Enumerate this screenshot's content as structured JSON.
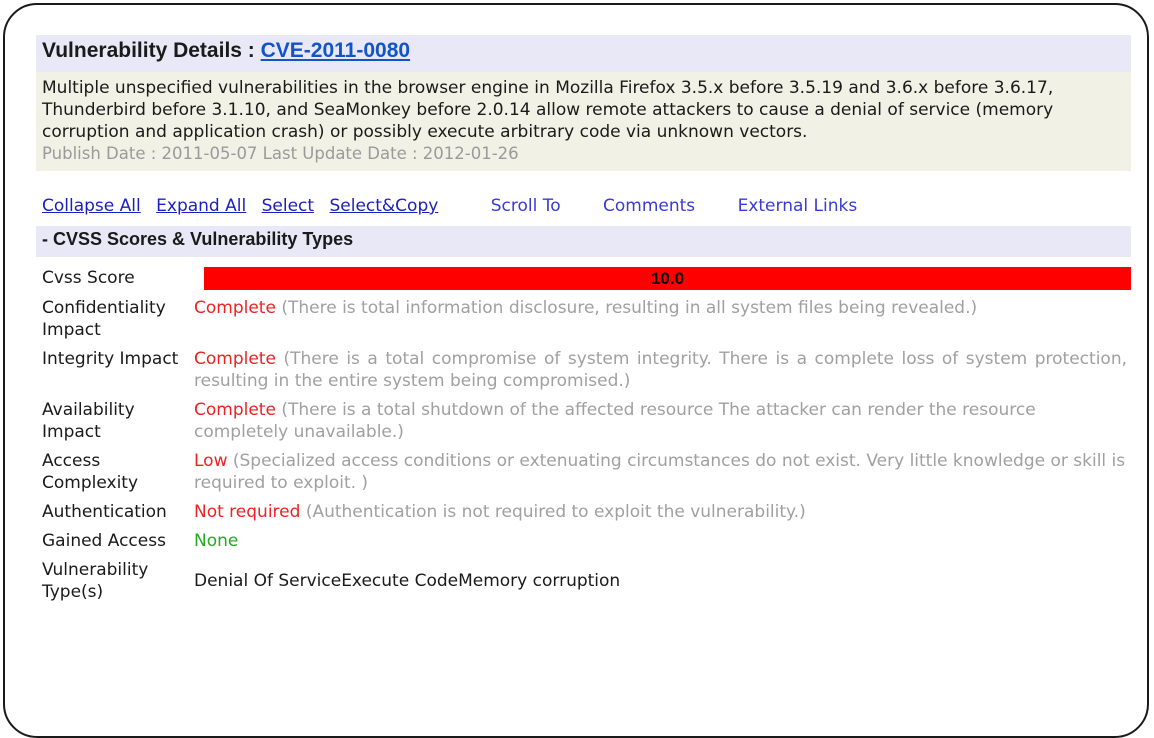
{
  "title": {
    "prefix": "Vulnerability Details : ",
    "cve_id": "CVE-2011-0080"
  },
  "summary": {
    "description": "Multiple unspecified vulnerabilities in the browser engine in Mozilla Firefox 3.5.x before 3.5.19 and 3.6.x before 3.6.17, Thunderbird before 3.1.10, and SeaMonkey before 2.0.14 allow remote attackers to cause a denial of service (memory corruption and application crash) or possibly execute arbitrary code via unknown vectors.",
    "dates": "Publish Date : 2011-05-07 Last Update Date : 2012-01-26"
  },
  "links": {
    "collapse_all": "Collapse All",
    "expand_all": "Expand All",
    "select": "Select",
    "select_copy": "Select&Copy",
    "scroll_to": "Scroll To",
    "comments": "Comments",
    "external_links": "External Links"
  },
  "section": {
    "title": "- CVSS Scores & Vulnerability Types"
  },
  "cvss": {
    "score_label": "Cvss Score",
    "score": "10.0",
    "score_color": "#ff0000",
    "rows": [
      {
        "label": "Confidentiality Impact",
        "value": "Complete",
        "detail": " (There is total information disclosure, resulting in all system files being revealed.)"
      },
      {
        "label": "Integrity Impact",
        "value": "Complete",
        "detail": " (There is a total compromise of system integrity. There is a complete loss of system protection, resulting in the entire system being compromised.)"
      },
      {
        "label": "Availability Impact",
        "value": "Complete",
        "detail": " (There is a total shutdown of the affected resource The attacker can render the resource completely unavailable.)"
      },
      {
        "label": "Access Complexity",
        "value": "Low",
        "detail": " (Specialized access conditions or extenuating circumstances do not exist. Very little knowledge or skill is required to exploit. )"
      },
      {
        "label": "Authentication",
        "value": "Not required",
        "detail": " (Authentication is not required to exploit the vulnerability.)"
      }
    ],
    "gained_access_label": "Gained Access",
    "gained_access_value": "None",
    "vuln_types_label": "Vulnerability Type(s)",
    "vuln_types_value": "Denial Of ServiceExecute CodeMemory corruption"
  },
  "colors": {
    "header_bg": "#e8e8f7",
    "summary_bg": "#f1f1e6",
    "severity_red": "#ee2222",
    "none_green": "#22aa22",
    "link_blue": "#1a1fbf"
  }
}
